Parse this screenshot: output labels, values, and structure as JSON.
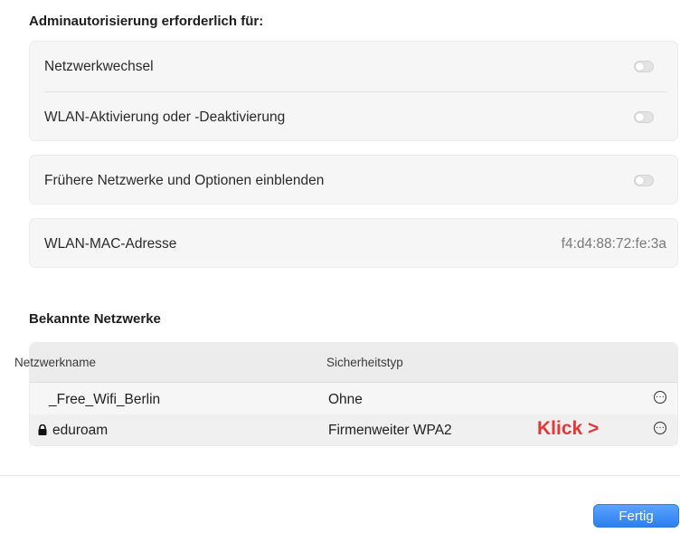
{
  "admin": {
    "heading": "Adminautorisierung erforderlich für:",
    "items": [
      {
        "label": "Netzwerkwechsel",
        "enabled": false
      },
      {
        "label": "WLAN-Aktivierung oder -Deaktivierung",
        "enabled": false
      }
    ]
  },
  "legacy": {
    "label": "Frühere Netzwerke und Optionen einblenden",
    "enabled": false
  },
  "mac": {
    "label": "WLAN-MAC-Adresse",
    "value": "f4:d4:88:72:fe:3a"
  },
  "known_networks": {
    "heading": "Bekannte Netzwerke",
    "columns": [
      "Netzwerkname",
      "Sicherheitstyp"
    ],
    "rows": [
      {
        "name": "_Free_Wifi_Berlin",
        "security": "Ohne",
        "locked": false,
        "icon": "more-options-icon"
      },
      {
        "name": "eduroam",
        "security": "Firmenweiter WPA2",
        "locked": true,
        "icon": "more-options-icon"
      }
    ]
  },
  "annotation": {
    "text": "Klick >",
    "color": "#e53535"
  },
  "footer": {
    "done_label": "Fertig"
  },
  "colors": {
    "accent": "#2b7ff0",
    "annotation_red": "#e53535"
  }
}
